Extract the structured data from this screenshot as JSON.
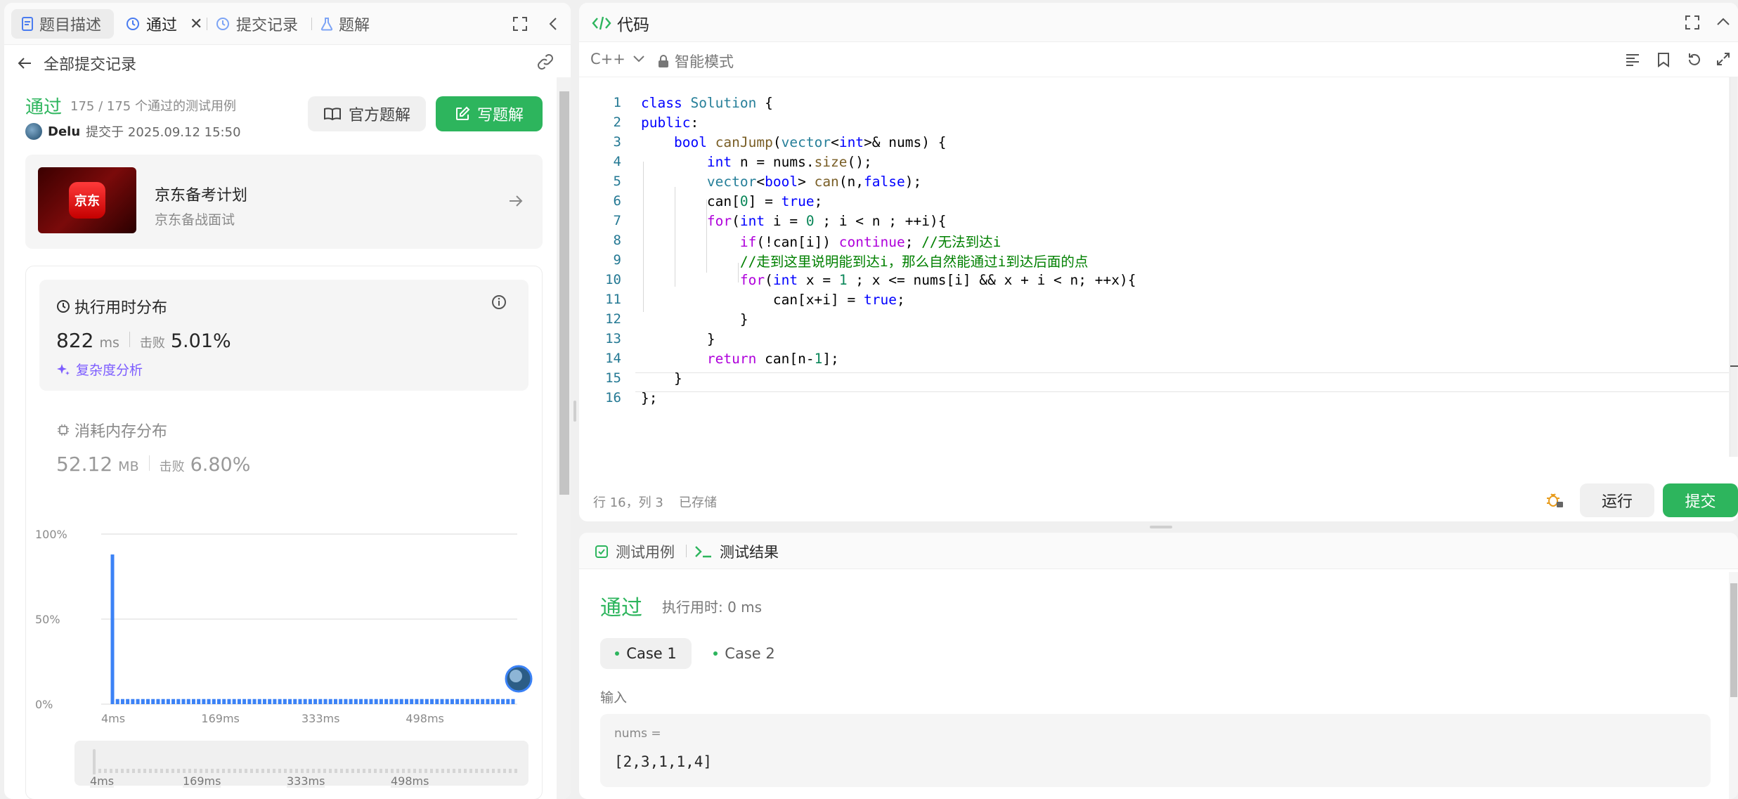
{
  "left_tabs": [
    {
      "label": "题目描述"
    },
    {
      "label": "通过"
    },
    {
      "label": "提交记录"
    },
    {
      "label": "题解"
    }
  ],
  "submission": {
    "back_label": "全部提交记录",
    "status": "通过",
    "tests": "175 / 175 个通过的测试用例",
    "user": "Delu",
    "submitted_at": "提交于 2025.09.12 15:50",
    "official_solution": "官方题解",
    "write_solution": "写题解"
  },
  "promo": {
    "logo_text": "京东",
    "title": "京东备考计划",
    "subtitle": "京东备战面试"
  },
  "runtime": {
    "title": "执行用时分布",
    "value": "822",
    "unit": "ms",
    "beats_label": "击败",
    "beats": "5.01%",
    "analysis": "复杂度分析"
  },
  "memory": {
    "title": "消耗内存分布",
    "value": "52.12",
    "unit": "MB",
    "beats_label": "击败",
    "beats": "6.80%"
  },
  "chart_data": {
    "type": "bar",
    "y_ticks": [
      "100%",
      "50%",
      "0%"
    ],
    "x_ticks": [
      "4ms",
      "169ms",
      "333ms",
      "498ms"
    ],
    "ylim": [
      0,
      100
    ],
    "values": [
      88,
      3,
      3,
      3,
      3,
      3,
      3,
      3,
      3,
      3,
      3,
      3,
      3,
      3,
      3,
      3,
      3,
      3,
      3,
      3,
      3,
      3,
      3,
      3,
      3,
      3,
      3,
      3,
      3,
      3,
      3,
      3,
      3,
      3,
      3,
      3,
      3,
      3,
      3,
      3,
      3,
      3,
      3,
      3,
      3,
      3,
      3,
      3,
      3,
      3,
      3,
      3,
      3,
      3,
      3,
      3,
      3,
      3,
      3,
      3,
      3,
      3,
      3,
      3,
      3,
      3,
      3,
      3,
      3,
      3,
      3,
      3,
      3,
      3,
      3,
      3,
      3,
      3,
      3,
      3
    ],
    "bar_color": "#3b82f6",
    "mini_ticks": [
      "4ms",
      "169ms",
      "333ms",
      "498ms"
    ]
  },
  "editor": {
    "title": "代码",
    "language": "C++",
    "mode": "智能模式",
    "status_pos": "行 16，列 3",
    "status_saved": "已存储",
    "run": "运行",
    "submit": "提交",
    "lines": [
      "1",
      "2",
      "3",
      "4",
      "5",
      "6",
      "7",
      "8",
      "9",
      "10",
      "11",
      "12",
      "13",
      "14",
      "15",
      "16"
    ]
  },
  "results": {
    "tab_cases": "测试用例",
    "tab_results": "测试结果",
    "status": "通过",
    "runtime": "执行用时: 0 ms",
    "case1": "Case 1",
    "case2": "Case 2",
    "input_label": "输入",
    "var_label": "nums =",
    "var_value": "[2,3,1,1,4]"
  },
  "colors": {
    "accent_green": "#2db55d",
    "chart_blue": "#3b82f6",
    "ai_purple": "#7c5cff"
  }
}
